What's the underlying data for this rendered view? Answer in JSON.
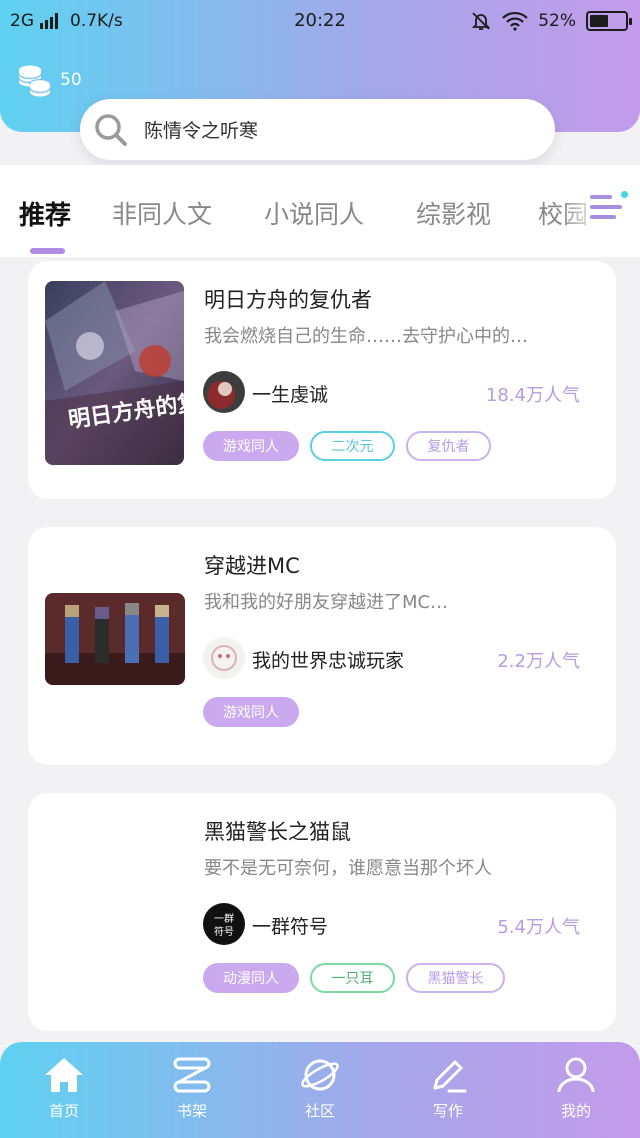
{
  "status_bar": {
    "network": "2G",
    "speed": "0.7K/s",
    "time": "20:22",
    "battery": "52%",
    "battery_level": 0.52
  },
  "header": {
    "coin_count": "50",
    "search_text": "陈情令之听寒"
  },
  "tabs": [
    {
      "label": "推荐",
      "active": true
    },
    {
      "label": "非同人文"
    },
    {
      "label": "小说同人"
    },
    {
      "label": "综影视"
    },
    {
      "label": "校园"
    }
  ],
  "books": [
    {
      "title": "明日方舟的复仇者",
      "description": "我会燃烧自己的生命……去守护心中的…",
      "author": "一生虔诚",
      "popularity": "18.4万人气",
      "cover_text": "明日方舟的复仇者",
      "tags": [
        {
          "label": "游戏同人",
          "style": "purple"
        },
        {
          "label": "二次元",
          "style": "cyan"
        },
        {
          "label": "复仇者",
          "style": "lavender"
        }
      ]
    },
    {
      "title": "穿越进MC",
      "description": "我和我的好朋友穿越进了MC…",
      "author": "我的世界忠诚玩家",
      "popularity": "2.2万人气",
      "tags": [
        {
          "label": "游戏同人",
          "style": "purple"
        }
      ]
    },
    {
      "title": "黑猫警长之猫鼠",
      "description": "要不是无可奈何，谁愿意当那个坏人",
      "author": "一群符号",
      "popularity": "5.4万人气",
      "avatar_text": "一群符号",
      "tags": [
        {
          "label": "动漫同人",
          "style": "purple"
        },
        {
          "label": "一只耳",
          "style": "green"
        },
        {
          "label": "黑猫警长",
          "style": "lavender"
        }
      ]
    }
  ],
  "bottom_nav": [
    {
      "label": "首页",
      "icon": "home-icon",
      "active": true
    },
    {
      "label": "书架",
      "icon": "bookshelf-icon"
    },
    {
      "label": "社区",
      "icon": "planet-icon"
    },
    {
      "label": "写作",
      "icon": "pen-icon"
    },
    {
      "label": "我的",
      "icon": "user-icon"
    }
  ],
  "colors": {
    "gradient_start": "#5ed1f1",
    "gradient_end": "#c39bea",
    "accent_purple": "#b08be6",
    "popularity": "#b79ce5"
  }
}
